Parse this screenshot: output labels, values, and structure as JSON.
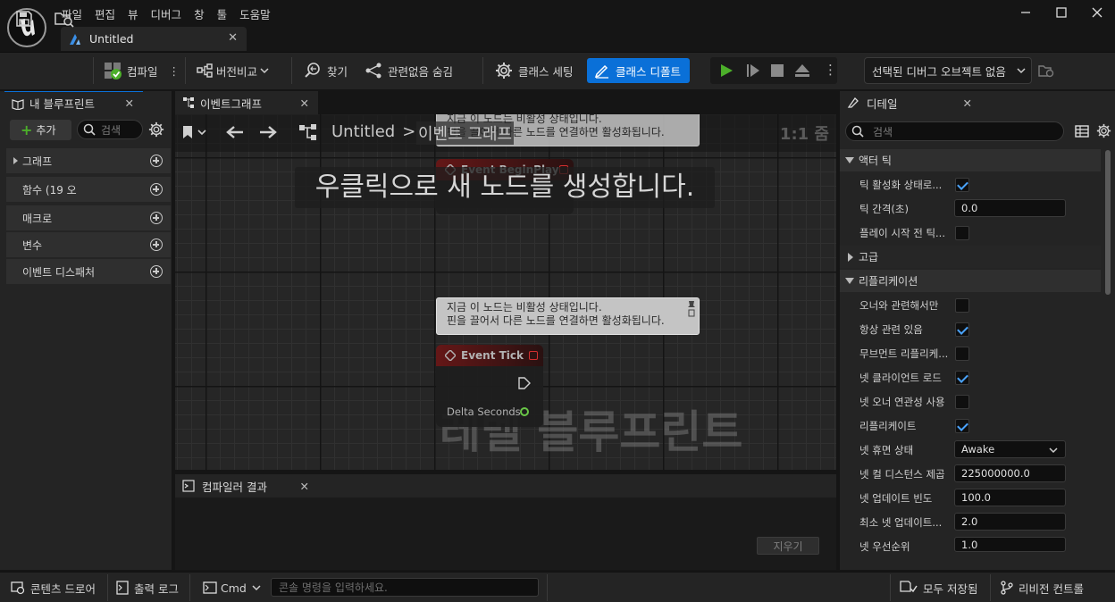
{
  "menu": [
    "파일",
    "편집",
    "뷰",
    "디버그",
    "창",
    "툴",
    "도움말"
  ],
  "doc_tab": {
    "title": "Untitled"
  },
  "toolbar": {
    "compile": "컴파일",
    "diff": "버전비교",
    "find": "찾기",
    "hide_unrelated": "관련없음 숨김",
    "class_settings": "클래스 세팅",
    "class_defaults": "클래스 디폴트",
    "debug_select": "선택된 디버그 오브젝트 없음"
  },
  "my_blueprint": {
    "tab": "내 블루프린트",
    "add": "추가",
    "search_placeholder": "검색",
    "categories": [
      "그래프",
      "함수 (19 오",
      "매크로",
      "변수",
      "이벤트 디스패처"
    ]
  },
  "event_graph": {
    "tab": "이벤트그래프",
    "breadcrumb_root": "Untitled",
    "breadcrumb_sep": ">",
    "breadcrumb_leaf": "이벤트 그래프",
    "zoom": "1:1 줌",
    "hint": "우클릭으로 새 노드를 생성합니다.",
    "watermark": "레벨 블루프린트",
    "comment_line1": "지금 이 노드는 비활성 상태입니다.",
    "comment_line2": "핀을 끌어서 다른 노드를 연결하면 활성화됩니다.",
    "node1_title": "Event BeginPlay",
    "node2_title": "Event Tick",
    "node2_pin": "Delta Seconds"
  },
  "compiler": {
    "tab": "컴파일러 결과",
    "clear": "지우기"
  },
  "details": {
    "tab": "디테일",
    "search_placeholder": "검색",
    "sections": {
      "tick": "액터 틱",
      "advanced": "고급",
      "replication": "리플리케이션"
    },
    "rows": {
      "tick_enabled": "틱 활성화 상태로...",
      "tick_interval": "틱 간격(초)",
      "tick_before_play": "플레이 시작 전 틱...",
      "only_relevant_owner": "오너와 관련해서만",
      "always_relevant": "항상 관련 있음",
      "replicate_movement": "무브먼트 리플리케...",
      "net_load_client": "넷 클라이언트 로드",
      "net_use_owner": "넷 오너 연관성 사용",
      "replicates": "리플리케이트",
      "net_dormancy": "넷 휴면 상태",
      "net_cull_distance": "넷 컬 디스턴스 제곱",
      "net_update_freq": "넷 업데이트 빈도",
      "min_net_update": "최소 넷 업데이트...",
      "net_priority": "넷 우선순위"
    },
    "values": {
      "tick_interval": "0.0",
      "net_dormancy": "Awake",
      "net_cull_distance": "225000000.0",
      "net_update_freq": "100.0",
      "min_net_update": "2.0",
      "net_priority": "1.0"
    }
  },
  "statusbar": {
    "content_drawer": "콘텐츠 드로어",
    "output_log": "출력 로그",
    "cmd": "Cmd",
    "console_placeholder": "콘솔 명령을 입력하세요.",
    "save_all": "모두 저장됨",
    "revision": "리비전 컨트롤"
  },
  "colors": {
    "accent": "#0a70d8",
    "play": "#4caf2a",
    "check": "#4aa3ff"
  }
}
